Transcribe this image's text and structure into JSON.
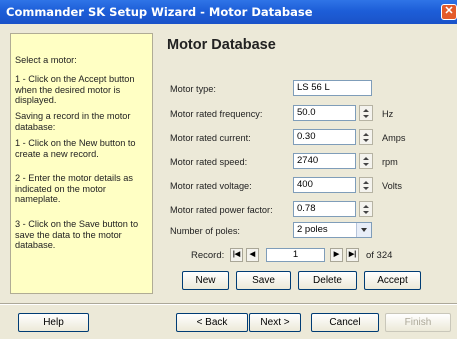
{
  "window": {
    "title": "Commander SK Setup Wizard - Motor Database"
  },
  "help": {
    "lines": [
      "Select a motor:",
      "1 - Click on the Accept button when the desired motor is displayed.",
      "Saving a record in the motor database:",
      "1 - Click on the New button to create a new record.",
      "2 - Enter the motor details as indicated on the motor nameplate.",
      "3 - Click on the Save button to save the data to the motor database."
    ]
  },
  "main": {
    "heading": "Motor Database",
    "fields": [
      {
        "label": "Motor type:",
        "value": "LS 56 L",
        "unit": ""
      },
      {
        "label": "Motor rated frequency:",
        "value": "50.0",
        "unit": "Hz"
      },
      {
        "label": "Motor rated current:",
        "value": "0.30",
        "unit": "Amps"
      },
      {
        "label": "Motor rated speed:",
        "value": "2740",
        "unit": "rpm"
      },
      {
        "label": "Motor rated voltage:",
        "value": "400",
        "unit": "Volts"
      },
      {
        "label": "Motor rated power factor:",
        "value": "0.78",
        "unit": ""
      }
    ],
    "poles_label": "Number of poles:",
    "poles_value": "2 poles",
    "record": {
      "label": "Record:",
      "current": "1",
      "total_text": "of 324"
    },
    "buttons": {
      "new": "New",
      "save": "Save",
      "delete": "Delete",
      "accept": "Accept"
    }
  },
  "footer": {
    "help": "Help",
    "back": "< Back",
    "next": "Next >",
    "cancel": "Cancel",
    "finish": "Finish"
  }
}
